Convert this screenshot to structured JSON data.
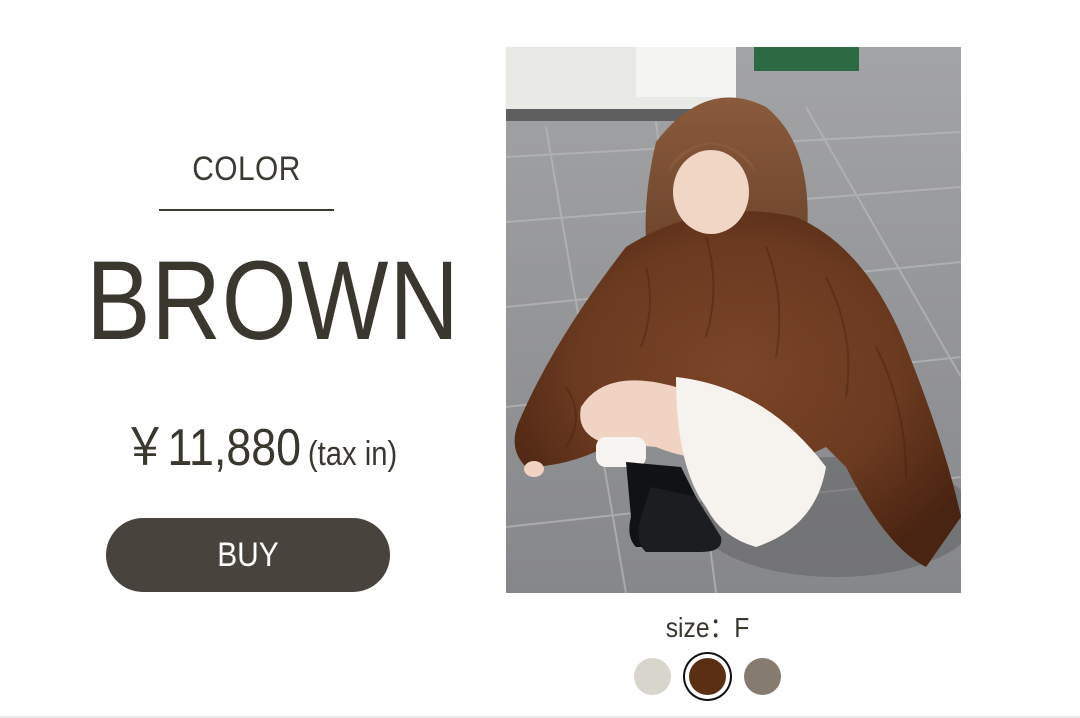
{
  "product": {
    "color_heading": "COLOR",
    "color_name": "BROWN",
    "price": "￥11,880",
    "tax_note": "(tax in)",
    "buy_label": "BUY",
    "size_label": "size",
    "size_separator": "：",
    "size_value": "F"
  },
  "swatches": [
    {
      "name": "beige",
      "color": "#d8d5cd",
      "selected": false
    },
    {
      "name": "brown",
      "color": "#5a2f13",
      "selected": true
    },
    {
      "name": "gray-brown",
      "color": "#857b6e",
      "selected": false
    }
  ],
  "colors": {
    "text": "#3a372f",
    "button": "#48443d",
    "button_text": "#ffffff"
  }
}
